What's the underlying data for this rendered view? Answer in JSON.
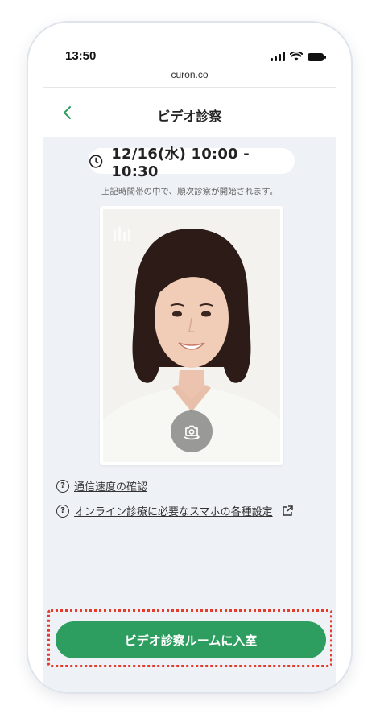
{
  "status_bar": {
    "time": "13:50"
  },
  "browser": {
    "url": "curon.co"
  },
  "nav": {
    "title": "ビデオ診察",
    "back_icon": "chevron-left-icon"
  },
  "appointment": {
    "time_range": "12/16(水) 10:00 - 10:30",
    "notice": "上記時間帯の中で、順次診察が開始されます。",
    "clock_icon": "clock-icon"
  },
  "camera": {
    "switch_icon": "camera-switch-icon",
    "level_icon": "audio-level-icon"
  },
  "links": [
    {
      "label": "通信速度の確認",
      "icon": "question-circle-icon"
    },
    {
      "label": "オンライン診療に必要なスマホの各種設定",
      "icon": "question-circle-icon",
      "trailing_icon": "external-link-icon"
    }
  ],
  "cta": {
    "label": "ビデオ診察ルームに入室"
  },
  "colors": {
    "accent": "#2d9d60",
    "highlight_frame": "#e53b2c",
    "content_bg": "#eef2f7"
  }
}
